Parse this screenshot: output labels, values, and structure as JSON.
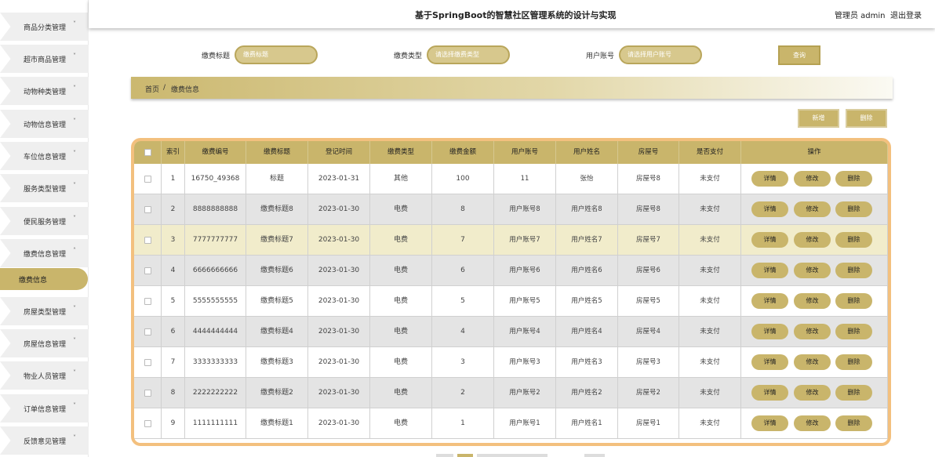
{
  "header": {
    "title": "基于SpringBoot的智慧社区管理系统的设计与实现",
    "user": "管理员 admin",
    "logout": "退出登录"
  },
  "sidebar": {
    "items": [
      {
        "label": "商品分类管理",
        "chevron": "˅"
      },
      {
        "label": "超市商品管理",
        "chevron": "˅"
      },
      {
        "label": "动物种类管理",
        "chevron": "˅"
      },
      {
        "label": "动物信息管理",
        "chevron": "˅"
      },
      {
        "label": "车位信息管理",
        "chevron": "˅"
      },
      {
        "label": "服务类型管理",
        "chevron": "˅"
      },
      {
        "label": "便民服务管理",
        "chevron": "˅"
      },
      {
        "label": "缴费信息管理",
        "chevron": "˄"
      },
      {
        "label": "缴费信息",
        "chevron": ""
      },
      {
        "label": "房屋类型管理",
        "chevron": "˅"
      },
      {
        "label": "房屋信息管理",
        "chevron": "˅"
      },
      {
        "label": "物业人员管理",
        "chevron": "˅"
      },
      {
        "label": "订单信息管理",
        "chevron": "˅"
      },
      {
        "label": "反馈意见管理",
        "chevron": "˅"
      }
    ]
  },
  "search": {
    "fields": [
      {
        "label": "缴费标题",
        "placeholder": "缴费标题"
      },
      {
        "label": "缴费类型",
        "placeholder": "请选择缴费类型"
      },
      {
        "label": "用户账号",
        "placeholder": "请选择用户账号"
      }
    ],
    "button": "查询"
  },
  "breadcrumb": {
    "home": "首页",
    "sep": "/",
    "current": "缴费信息"
  },
  "toolbar": {
    "add": "新增",
    "delete": "删除"
  },
  "table": {
    "headers": [
      "",
      "索引",
      "缴费编号",
      "缴费标题",
      "登记时间",
      "缴费类型",
      "缴费金额",
      "用户账号",
      "用户姓名",
      "房屋号",
      "是否支付",
      "操作"
    ],
    "actions": [
      "详情",
      "修改",
      "删除"
    ],
    "rows": [
      [
        "1",
        "16750_49368",
        "标题",
        "2023-01-31",
        "其他",
        "100",
        "11",
        "张怡",
        "房屋号8",
        "未支付"
      ],
      [
        "2",
        "8888888888",
        "缴费标题8",
        "2023-01-30",
        "电费",
        "8",
        "用户账号8",
        "用户姓名8",
        "房屋号8",
        "未支付"
      ],
      [
        "3",
        "7777777777",
        "缴费标题7",
        "2023-01-30",
        "电费",
        "7",
        "用户账号7",
        "用户姓名7",
        "房屋号7",
        "未支付"
      ],
      [
        "4",
        "6666666666",
        "缴费标题6",
        "2023-01-30",
        "电费",
        "6",
        "用户账号6",
        "用户姓名6",
        "房屋号6",
        "未支付"
      ],
      [
        "5",
        "5555555555",
        "缴费标题5",
        "2023-01-30",
        "电费",
        "5",
        "用户账号5",
        "用户姓名5",
        "房屋号5",
        "未支付"
      ],
      [
        "6",
        "4444444444",
        "缴费标题4",
        "2023-01-30",
        "电费",
        "4",
        "用户账号4",
        "用户姓名4",
        "房屋号4",
        "未支付"
      ],
      [
        "7",
        "3333333333",
        "缴费标题3",
        "2023-01-30",
        "电费",
        "3",
        "用户账号3",
        "用户姓名3",
        "房屋号3",
        "未支付"
      ],
      [
        "8",
        "2222222222",
        "缴费标题2",
        "2023-01-30",
        "电费",
        "2",
        "用户账号2",
        "用户姓名2",
        "房屋号2",
        "未支付"
      ],
      [
        "9",
        "1111111111",
        "缴费标题1",
        "2023-01-30",
        "电费",
        "1",
        "用户账号1",
        "用户姓名1",
        "房屋号1",
        "未支付"
      ]
    ]
  },
  "colors": {
    "accent": "#c9b56b",
    "table_border": "#f3c07e"
  }
}
